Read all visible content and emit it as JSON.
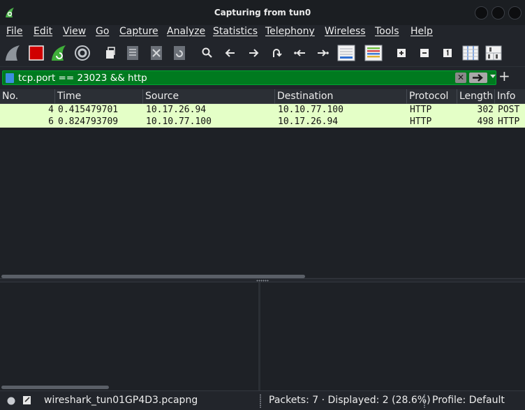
{
  "window": {
    "title": "Capturing from tun0"
  },
  "menu": {
    "items": [
      "File",
      "Edit",
      "View",
      "Go",
      "Capture",
      "Analyze",
      "Statistics",
      "Telephony",
      "Wireless",
      "Tools",
      "Help"
    ]
  },
  "filter": {
    "value": "tcp.port == 23023 && http",
    "valid_color": "#007a1f"
  },
  "packet_list": {
    "columns": [
      "No.",
      "Time",
      "Source",
      "Destination",
      "Protocol",
      "Length",
      "Info"
    ],
    "rows": [
      [
        "4",
        "0.415479701",
        "10.17.26.94",
        "10.10.77.100",
        "HTTP",
        "302",
        "POST"
      ],
      [
        "6",
        "0.824793709",
        "10.10.77.100",
        "10.17.26.94",
        "HTTP",
        "498",
        "HTTP"
      ]
    ],
    "row_color": "#e4ffc7"
  },
  "status": {
    "file": "wireshark_tun01GP4D3.pcapng",
    "packets": "Packets: 7 · Displayed: 2 (28.6%)",
    "profile": "Profile: Default"
  },
  "icons": [
    "wireshark-fin-icon",
    "shark-fin-start-icon",
    "stop-capture-icon",
    "restart-capture-icon",
    "capture-options-icon",
    "open-file-icon",
    "save-file-icon",
    "close-file-icon",
    "reload-file-icon",
    "find-packet-icon",
    "go-back-icon",
    "go-forward-icon",
    "go-to-packet-icon",
    "first-packet-icon",
    "last-packet-icon",
    "autoscroll-icon",
    "colorize-icon",
    "zoom-in-icon",
    "zoom-out-icon",
    "normal-size-icon",
    "resize-columns-icon",
    "layout-icon"
  ]
}
